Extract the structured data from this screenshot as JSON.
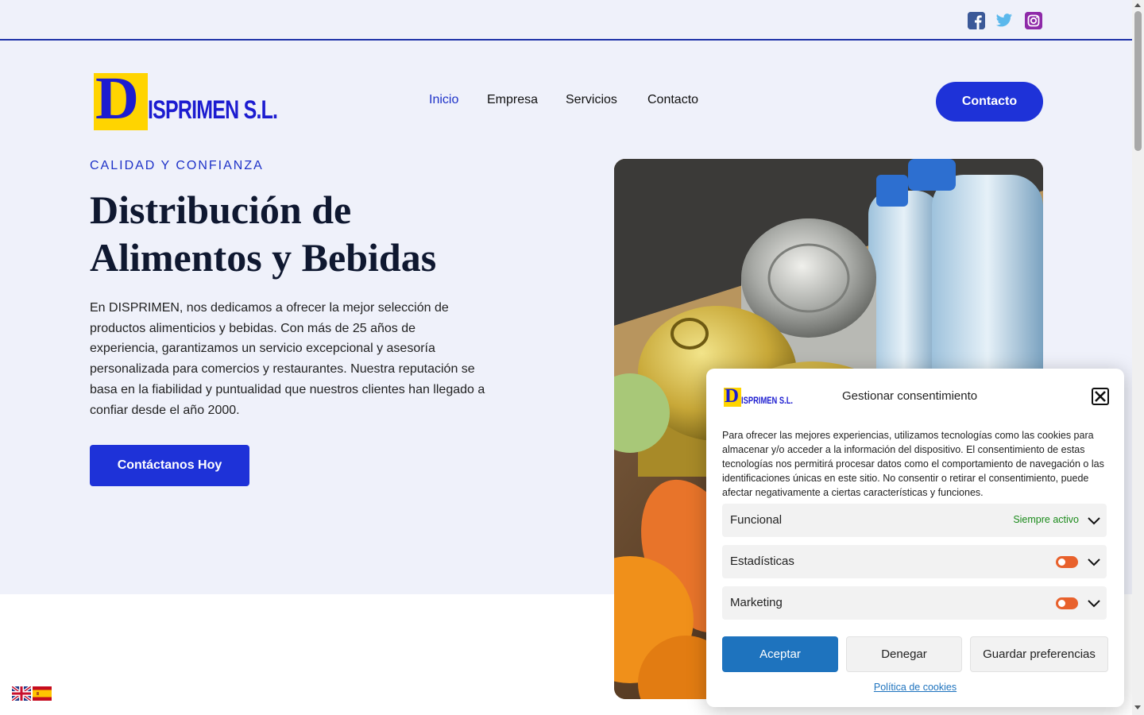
{
  "nav": {
    "items": [
      "Inicio",
      "Empresa",
      "Servicios",
      "Contacto"
    ],
    "cta_label": "Contacto",
    "active_color": "#1e32c8"
  },
  "logo": {
    "letter": "D",
    "rest": "ISPRIMEN S.L."
  },
  "social": {
    "icons": [
      "facebook-icon",
      "twitter-icon",
      "instagram-icon"
    ]
  },
  "hero": {
    "eyebrow": "CALIDAD Y CONFIANZA",
    "title_line1": "Distribución de",
    "title_line2": "Alimentos y Bebidas",
    "intro": "En DISPRIMEN, nos dedicamos a ofrecer la mejor selección de productos alimenticios y bebidas. Con más de 25 años de experiencia, garantizamos un servicio excepcional y asesoría personalizada para comercios y restaurantes. Nuestra reputación se basa en la fiabilidad y puntualidad que nuestros clientes han llegado a confiar desde el año 2000.",
    "button_label": "Contáctanos Hoy"
  },
  "consent": {
    "title": "Gestionar consentimiento",
    "text": "Para ofrecer las mejores experiencias, utilizamos tecnologías como las cookies para almacenar y/o acceder a la información del dispositivo. El consentimiento de estas tecnologías nos permitirá procesar datos como el comportamiento de navegación o las identificaciones únicas en este sitio. No consentir o retirar el consentimiento, puede afectar negativamente a ciertas características y funciones.",
    "categories": [
      {
        "label": "Funcional",
        "status": "Siempre activo"
      },
      {
        "label": "Estadísticas",
        "status": ""
      },
      {
        "label": "Marketing",
        "status": ""
      }
    ],
    "accept_label": "Aceptar",
    "deny_label": "Denegar",
    "save_label": "Guardar preferencias",
    "policy_link": "Política de cookies"
  },
  "colors": {
    "brand_blue": "#1e32d8",
    "hero_bg": "#eff1fa",
    "accept_blue": "#1e73be",
    "toggle_orange": "#e8612c",
    "status_green": "#1a8a1a"
  }
}
